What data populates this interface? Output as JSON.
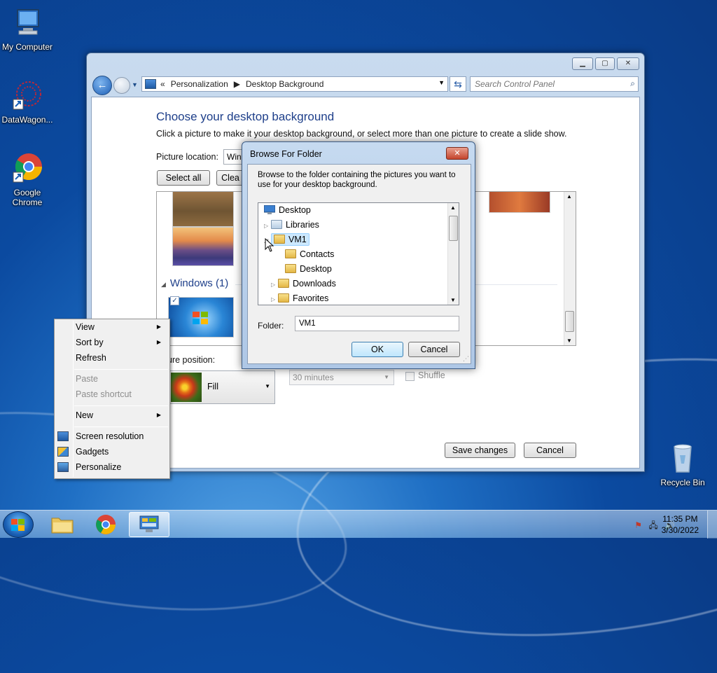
{
  "desktop": {
    "icons": [
      {
        "label": "My Computer"
      },
      {
        "label": "DataWagon..."
      },
      {
        "label": "Google Chrome"
      },
      {
        "label": "Recycle Bin"
      }
    ]
  },
  "window": {
    "breadcrumb": [
      "Personalization",
      "Desktop Background"
    ],
    "search_placeholder": "Search Control Panel",
    "heading": "Choose your desktop background",
    "subtext": "Click a picture to make it your desktop background, or select more than one picture to create a slide show.",
    "picture_location_label": "Picture location:",
    "picture_location_value": "Wind",
    "select_all": "Select all",
    "clear_all": "Clea",
    "group_label": "Windows (1)",
    "picture_position_label": "ure position:",
    "position_value": "Fill",
    "interval_value": "30 minutes",
    "shuffle_label": "Shuffle",
    "save_changes": "Save changes",
    "cancel": "Cancel"
  },
  "dialog": {
    "title": "Browse For Folder",
    "close_glyph": "✕",
    "instruction": "Browse to the folder containing the pictures you want to use for your desktop background.",
    "tree": [
      {
        "label": "Desktop",
        "expander": ""
      },
      {
        "label": "Libraries",
        "expander": "▷"
      },
      {
        "label": "VM1",
        "expander": "◢"
      },
      {
        "label": "Contacts",
        "expander": ""
      },
      {
        "label": "Desktop",
        "expander": ""
      },
      {
        "label": "Downloads",
        "expander": "▷"
      },
      {
        "label": "Favorites",
        "expander": "▷"
      }
    ],
    "folder_label": "Folder:",
    "folder_value": "VM1",
    "ok": "OK",
    "cancel": "Cancel"
  },
  "context_menu": {
    "items": [
      {
        "label": "View",
        "has_submenu": true
      },
      {
        "label": "Sort by",
        "has_submenu": true
      },
      {
        "label": "Refresh"
      },
      {
        "label": "Paste",
        "disabled": true
      },
      {
        "label": "Paste shortcut",
        "disabled": true
      },
      {
        "label": "New",
        "has_submenu": true
      },
      {
        "label": "Screen resolution",
        "icon": "display-icon"
      },
      {
        "label": "Gadgets",
        "icon": "gadgets-icon"
      },
      {
        "label": "Personalize",
        "icon": "personalize-icon"
      }
    ],
    "submenu_arrow": "▶"
  },
  "taskbar": {
    "time": "11:35 PM",
    "date": "3/30/2022"
  },
  "colors": {
    "accent": "#1e3f8a",
    "selection": "#cce8ff"
  }
}
